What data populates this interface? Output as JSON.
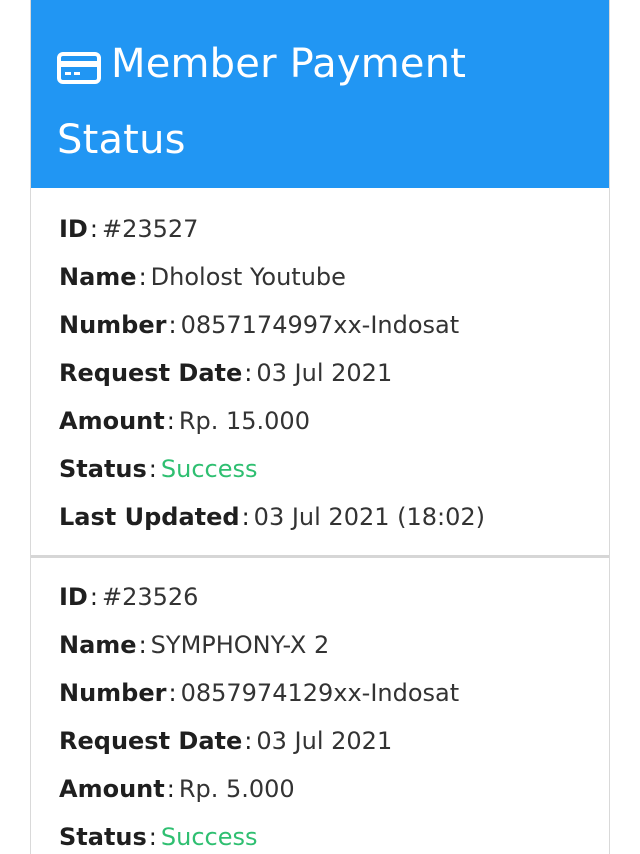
{
  "header": {
    "title_line1": "Member Payment",
    "title_line2": "Status",
    "icon": "credit-card-icon",
    "background": "#2196f3"
  },
  "colors": {
    "success": "#2fbf71"
  },
  "payments": [
    {
      "id_label": "ID",
      "id_value": "#23527",
      "name_label": "Name",
      "name_value": "Dholost Youtube",
      "number_label": "Number",
      "number_value": "0857174997xx-Indosat",
      "request_label": "Request Date",
      "request_value": "03 Jul 2021",
      "amount_label": "Amount",
      "amount_value": "Rp. 15.000",
      "status_label": "Status",
      "status_value": "Success",
      "updated_label": "Last Updated",
      "updated_value": "03 Jul 2021 (18:02)"
    },
    {
      "id_label": "ID",
      "id_value": "#23526",
      "name_label": "Name",
      "name_value": "SYMPHONY-X 2",
      "number_label": "Number",
      "number_value": "0857974129xx-Indosat",
      "request_label": "Request Date",
      "request_value": "03 Jul 2021",
      "amount_label": "Amount",
      "amount_value": "Rp. 5.000",
      "status_label": "Status",
      "status_value": "Success"
    }
  ]
}
